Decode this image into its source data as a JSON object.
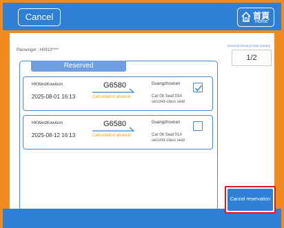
{
  "header": {
    "cancel_label": "Cancel",
    "home_label_zh": "首頁",
    "home_label_en": "Home"
  },
  "passenger": {
    "label": "Passenger : H0913****"
  },
  "summary": {
    "label": "Selected ticket(s)/Total ticket(s)",
    "count": "1/2"
  },
  "reserved": {
    "title": "Reserved",
    "tickets": [
      {
        "from": "HKWestKowloon",
        "date": "2025-08-01 16:13",
        "train": "G6580",
        "status": "Cancellation allowed",
        "to": "Guangzhounan",
        "seat_line1": "Car:08 Seat:03A",
        "seat_line2": "second-class seat",
        "checked": true
      },
      {
        "from": "HKWestKowloon",
        "date": "2025-08-12 16:13",
        "train": "G6580",
        "status": "Cancellation allowed",
        "to": "Guangzhounan",
        "seat_line1": "Car:06 Seat:01A",
        "seat_line2": "second-class seat",
        "checked": false
      }
    ]
  },
  "actions": {
    "cancel_reservation_label": "Cancel reservation"
  },
  "colors": {
    "frame": "#f28b1f",
    "primary": "#2f7fd4",
    "highlight": "#e01818",
    "status": "#e9a51e"
  }
}
